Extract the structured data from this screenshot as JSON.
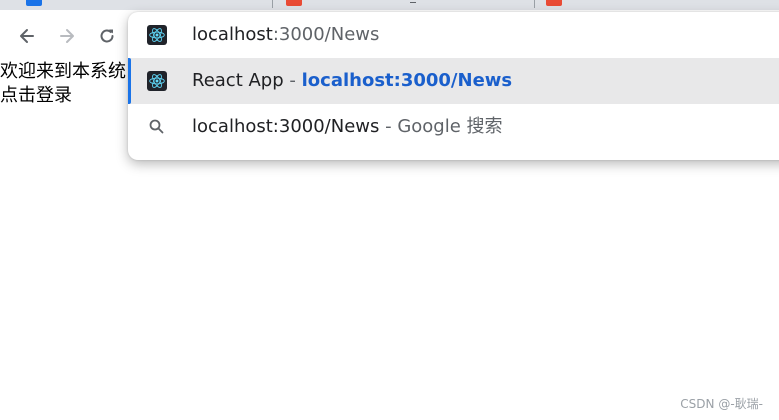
{
  "colors": {
    "accent": "#1a73e8",
    "url_highlight": "#1a5fcc",
    "selected_row_bg": "#e8e8e9",
    "tab_favicon": "#e94b35",
    "react_logo": "#61dafb"
  },
  "tabs": [
    {
      "favicon": "blue-tab-favicon"
    },
    {
      "favicon": "red-tab-favicon"
    },
    {
      "favicon": "red-tab-favicon"
    }
  ],
  "toolbar": {
    "back_icon": "arrow-left-icon",
    "forward_icon": "arrow-right-icon",
    "reload_icon": "reload-icon"
  },
  "page": {
    "line1": "欢迎来到本系统",
    "line2": "点击登录"
  },
  "omnibox": {
    "input_host": "localhost",
    "input_rest": ":3000/News",
    "suggestions": [
      {
        "icon": "react-logo-icon",
        "title": "React App",
        "separator": " - ",
        "url": "localhost:3000/News",
        "selected": true
      },
      {
        "icon": "search-icon",
        "title": "localhost:3000/News",
        "separator": " - ",
        "engine": "Google 搜索",
        "selected": false
      }
    ]
  },
  "watermark": "CSDN @-耿瑞-"
}
